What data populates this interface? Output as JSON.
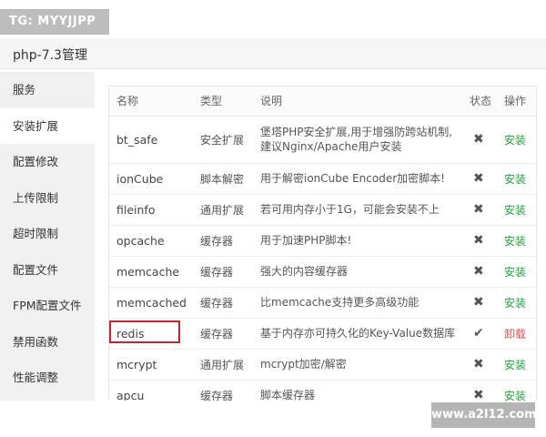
{
  "watermarks": {
    "top_left": "TG: MYYJJPP",
    "bottom_right": "www.a2l12.com"
  },
  "header": {
    "title": "php-7.3管理"
  },
  "sidebar": {
    "items": [
      {
        "label": "服务",
        "active": false
      },
      {
        "label": "安装扩展",
        "active": true
      },
      {
        "label": "配置修改",
        "active": false
      },
      {
        "label": "上传限制",
        "active": false
      },
      {
        "label": "超时限制",
        "active": false
      },
      {
        "label": "配置文件",
        "active": false
      },
      {
        "label": "FPM配置文件",
        "active": false
      },
      {
        "label": "禁用函数",
        "active": false
      },
      {
        "label": "性能调整",
        "active": false
      }
    ]
  },
  "table": {
    "columns": [
      "名称",
      "类型",
      "说明",
      "状态",
      "操作"
    ],
    "rows": [
      {
        "name": "bt_safe",
        "type": "安全扩展",
        "desc": "堡塔PHP安全扩展,用于增强防跨站机制,建议Nginx/Apache用户安装",
        "status": "✖",
        "action": "安装",
        "action_type": "install"
      },
      {
        "name": "ionCube",
        "type": "脚本解密",
        "desc": "用于解密ionCube Encoder加密脚本!",
        "status": "✖",
        "action": "安装",
        "action_type": "install"
      },
      {
        "name": "fileinfo",
        "type": "通用扩展",
        "desc": "若可用内存小于1G，可能会安装不上",
        "status": "✖",
        "action": "安装",
        "action_type": "install"
      },
      {
        "name": "opcache",
        "type": "缓存器",
        "desc": "用于加速PHP脚本!",
        "status": "✖",
        "action": "安装",
        "action_type": "install"
      },
      {
        "name": "memcache",
        "type": "缓存器",
        "desc": "强大的内容缓存器",
        "status": "✖",
        "action": "安装",
        "action_type": "install"
      },
      {
        "name": "memcached",
        "type": "缓存器",
        "desc": "比memcache支持更多高级功能",
        "status": "✖",
        "action": "安装",
        "action_type": "install"
      },
      {
        "name": "redis",
        "type": "缓存器",
        "desc": "基于内存亦可持久化的Key-Value数据库",
        "status": "✔",
        "action": "卸载",
        "action_type": "uninstall"
      },
      {
        "name": "mcrypt",
        "type": "通用扩展",
        "desc": "mcrypt加密/解密",
        "status": "✖",
        "action": "安装",
        "action_type": "install"
      },
      {
        "name": "apcu",
        "type": "缓存器",
        "desc": "脚本缓存器",
        "status": "✖",
        "action": "安装",
        "action_type": "install"
      }
    ]
  },
  "colors": {
    "install": "#20a53a",
    "uninstall": "#d9534f",
    "highlight_box": "#c0282d"
  }
}
